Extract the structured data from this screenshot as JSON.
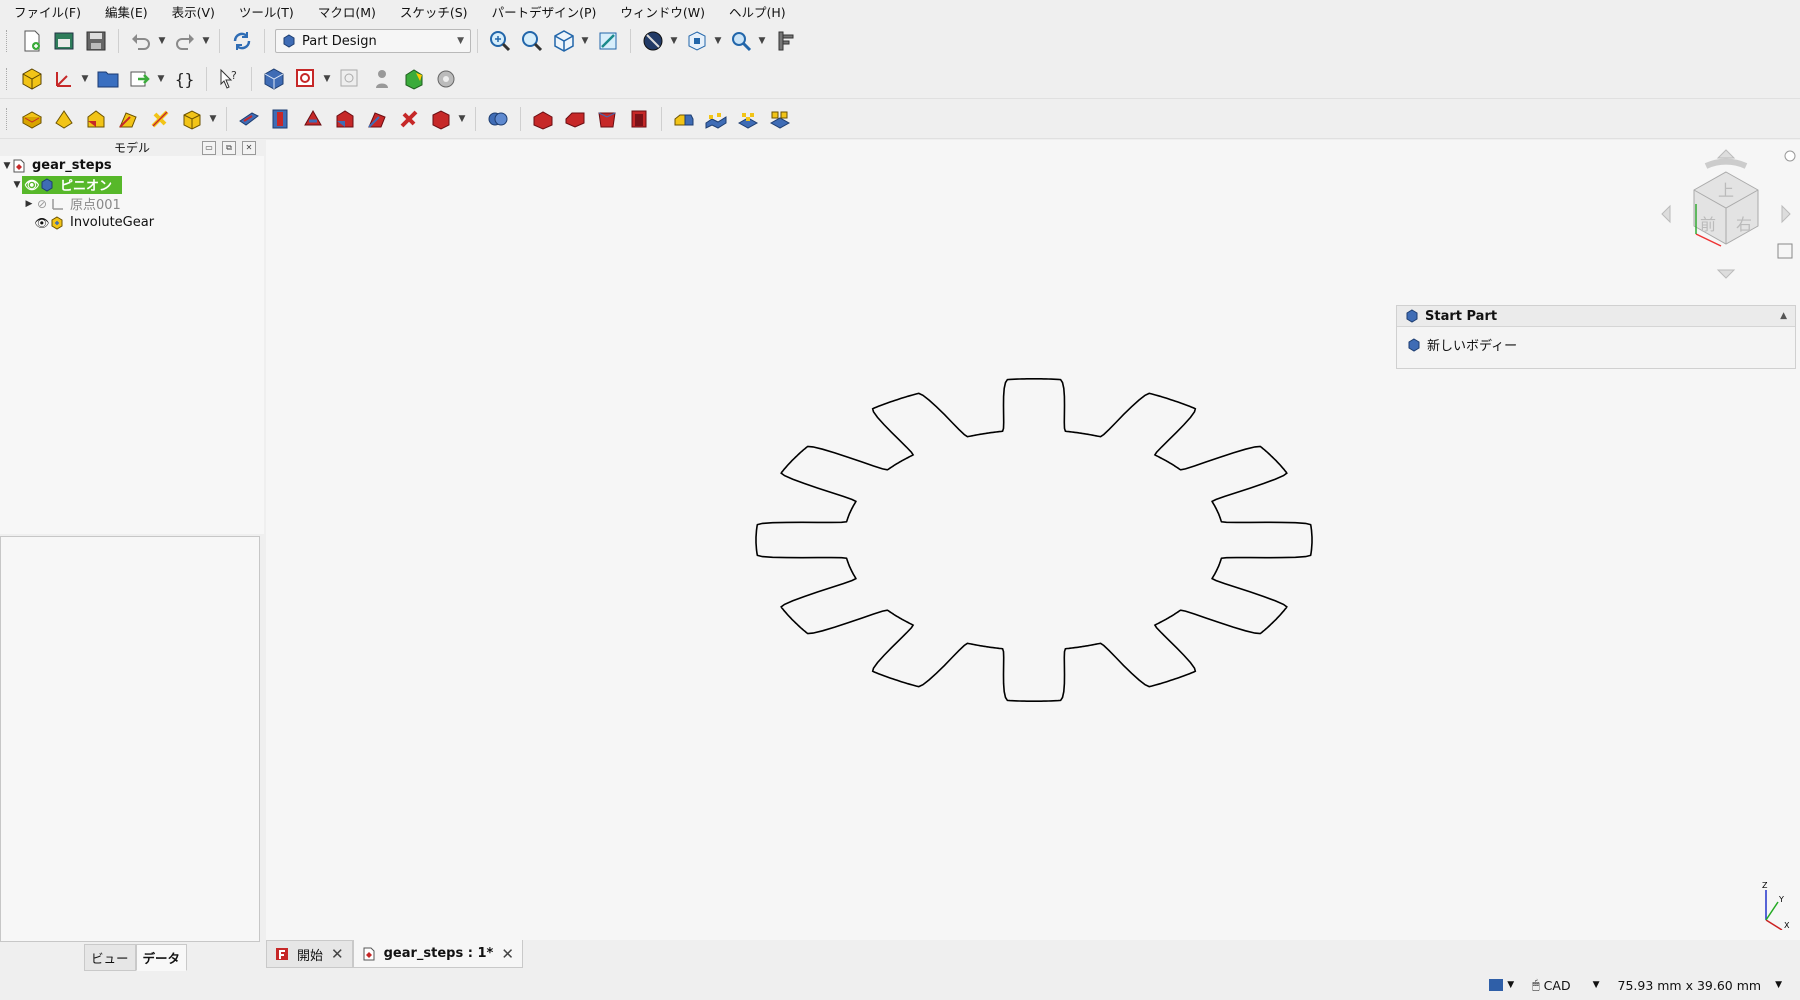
{
  "menu": [
    "ファイル(F)",
    "編集(E)",
    "表示(V)",
    "ツール(T)",
    "マクロ(M)",
    "スケッチ(S)",
    "パートデザイン(P)",
    "ウィンドウ(W)",
    "ヘルプ(H)"
  ],
  "workbench": {
    "selected": "Part Design"
  },
  "panel": {
    "title": "モデル"
  },
  "tree": {
    "document": "gear_steps",
    "body": "ピニオン",
    "origin": "原点001",
    "gear": "InvoluteGear"
  },
  "bottom_tabs": {
    "view": "ビュー",
    "data": "データ"
  },
  "task_panel": {
    "title": "Start Part",
    "action": "新しいボディー"
  },
  "nav_cube": {
    "top": "上",
    "front": "前",
    "right": "右"
  },
  "axes": {
    "x": "X",
    "y": "Y",
    "z": "Z"
  },
  "doc_tabs": {
    "start": "開始",
    "document": "gear_steps : 1*"
  },
  "status": {
    "nav_style": "CAD",
    "dimensions": "75.93 mm x 39.60 mm"
  },
  "colors": {
    "selection": "#57b82a",
    "body_blue": "#3f6cb5",
    "feature_red": "#d4202a",
    "feature_yellow": "#f2c417"
  }
}
